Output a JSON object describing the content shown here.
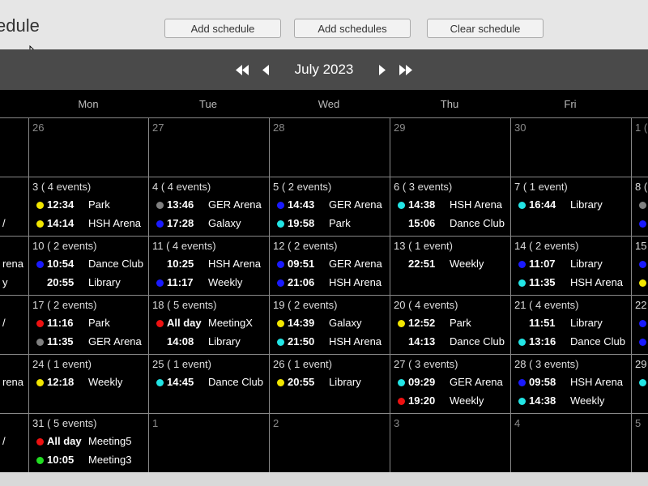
{
  "header": {
    "title": "edule",
    "buttons": [
      "Add schedule",
      "Add schedules",
      "Clear schedule"
    ]
  },
  "nav": {
    "month": "July 2023",
    "icons": [
      "double-left-arrow-icon",
      "left-arrow-icon",
      "right-arrow-icon",
      "double-right-arrow-icon"
    ]
  },
  "day_headers": [
    "Mon",
    "Tue",
    "Wed",
    "Thu",
    "Fri"
  ],
  "colors": {
    "yellow": "#f2e600",
    "gray": "#808080",
    "blue": "#1a1aff",
    "cyan": "#22e5e5",
    "red": "#ee1111",
    "green": "#22dd22",
    "black": "#000000"
  },
  "weeks": [
    [
      {
        "label": "",
        "events": []
      },
      {
        "label": "26",
        "events": []
      },
      {
        "label": "27",
        "events": []
      },
      {
        "label": "28",
        "events": []
      },
      {
        "label": "29",
        "events": []
      },
      {
        "label": "30",
        "events": []
      },
      {
        "label": "1 (",
        "events": []
      }
    ],
    [
      {
        "label": "",
        "events": [
          {
            "color": "black",
            "time": "",
            "place": ""
          },
          {
            "color": "black",
            "time": "",
            "place": "/"
          }
        ]
      },
      {
        "label": "3 ( 4 events)",
        "events": [
          {
            "color": "yellow",
            "time": "12:34",
            "place": "Park"
          },
          {
            "color": "yellow",
            "time": "14:14",
            "place": "HSH Arena"
          }
        ]
      },
      {
        "label": "4 ( 4 events)",
        "events": [
          {
            "color": "gray",
            "time": "13:46",
            "place": "GER Arena"
          },
          {
            "color": "blue",
            "time": "17:28",
            "place": "Galaxy"
          }
        ]
      },
      {
        "label": "5 ( 2 events)",
        "events": [
          {
            "color": "blue",
            "time": "14:43",
            "place": "GER Arena"
          },
          {
            "color": "cyan",
            "time": "19:58",
            "place": "Park"
          }
        ]
      },
      {
        "label": "6 ( 3 events)",
        "events": [
          {
            "color": "cyan",
            "time": "14:38",
            "place": "HSH Arena"
          },
          {
            "color": "black",
            "time": "15:06",
            "place": "Dance Club"
          }
        ]
      },
      {
        "label": "7 ( 1 event)",
        "events": [
          {
            "color": "cyan",
            "time": "16:44",
            "place": "Library"
          }
        ]
      },
      {
        "label": "8 (",
        "events": [
          {
            "color": "gray",
            "time": "",
            "place": ""
          },
          {
            "color": "blue",
            "time": "",
            "place": ""
          }
        ]
      }
    ],
    [
      {
        "label": "",
        "events": [
          {
            "color": "black",
            "time": "",
            "place": "rena"
          },
          {
            "color": "black",
            "time": "",
            "place": "y"
          }
        ]
      },
      {
        "label": "10 ( 2 events)",
        "events": [
          {
            "color": "blue",
            "time": "10:54",
            "place": "Dance Club"
          },
          {
            "color": "black",
            "time": "20:55",
            "place": "Library"
          }
        ]
      },
      {
        "label": "11 ( 4 events)",
        "events": [
          {
            "color": "black",
            "time": "10:25",
            "place": "HSH Arena"
          },
          {
            "color": "blue",
            "time": "11:17",
            "place": "Weekly"
          }
        ]
      },
      {
        "label": "12 ( 2 events)",
        "events": [
          {
            "color": "blue",
            "time": "09:51",
            "place": "GER Arena"
          },
          {
            "color": "blue",
            "time": "21:06",
            "place": "HSH Arena"
          }
        ]
      },
      {
        "label": "13 ( 1 event)",
        "events": [
          {
            "color": "black",
            "time": "22:51",
            "place": "Weekly"
          }
        ]
      },
      {
        "label": "14 ( 2 events)",
        "events": [
          {
            "color": "blue",
            "time": "11:07",
            "place": "Library"
          },
          {
            "color": "cyan",
            "time": "11:35",
            "place": "HSH Arena"
          }
        ]
      },
      {
        "label": "15",
        "events": [
          {
            "color": "blue",
            "time": "",
            "place": ""
          },
          {
            "color": "yellow",
            "time": "",
            "place": ""
          }
        ]
      }
    ],
    [
      {
        "label": "",
        "events": [
          {
            "color": "black",
            "time": "",
            "place": "/"
          },
          {
            "color": "black",
            "time": "",
            "place": ""
          }
        ]
      },
      {
        "label": "17 ( 2 events)",
        "events": [
          {
            "color": "red",
            "time": "11:16",
            "place": "Park"
          },
          {
            "color": "gray",
            "time": "11:35",
            "place": "GER Arena"
          }
        ]
      },
      {
        "label": "18 ( 5 events)",
        "events": [
          {
            "color": "red",
            "time": "All day",
            "place": "MeetingX"
          },
          {
            "color": "black",
            "time": "14:08",
            "place": "Library"
          }
        ]
      },
      {
        "label": "19 ( 2 events)",
        "events": [
          {
            "color": "yellow",
            "time": "14:39",
            "place": "Galaxy"
          },
          {
            "color": "cyan",
            "time": "21:50",
            "place": "HSH Arena"
          }
        ]
      },
      {
        "label": "20 ( 4 events)",
        "events": [
          {
            "color": "yellow",
            "time": "12:52",
            "place": "Park"
          },
          {
            "color": "black",
            "time": "14:13",
            "place": "Dance Club"
          }
        ]
      },
      {
        "label": "21 ( 4 events)",
        "events": [
          {
            "color": "black",
            "time": "11:51",
            "place": "Library"
          },
          {
            "color": "cyan",
            "time": "13:16",
            "place": "Dance Club"
          }
        ]
      },
      {
        "label": "22",
        "events": [
          {
            "color": "blue",
            "time": "",
            "place": ""
          },
          {
            "color": "blue",
            "time": "",
            "place": ""
          }
        ]
      }
    ],
    [
      {
        "label": "",
        "events": [
          {
            "color": "black",
            "time": "",
            "place": "rena"
          }
        ]
      },
      {
        "label": "24 ( 1 event)",
        "events": [
          {
            "color": "yellow",
            "time": "12:18",
            "place": "Weekly"
          }
        ]
      },
      {
        "label": "25 ( 1 event)",
        "events": [
          {
            "color": "cyan",
            "time": "14:45",
            "place": "Dance Club"
          }
        ]
      },
      {
        "label": "26 ( 1 event)",
        "events": [
          {
            "color": "yellow",
            "time": "20:55",
            "place": "Library"
          }
        ]
      },
      {
        "label": "27 ( 3 events)",
        "events": [
          {
            "color": "cyan",
            "time": "09:29",
            "place": "GER Arena"
          },
          {
            "color": "red",
            "time": "19:20",
            "place": "Weekly"
          }
        ]
      },
      {
        "label": "28 ( 3 events)",
        "events": [
          {
            "color": "blue",
            "time": "09:58",
            "place": "HSH Arena"
          },
          {
            "color": "cyan",
            "time": "14:38",
            "place": "Weekly"
          }
        ]
      },
      {
        "label": "29",
        "events": [
          {
            "color": "cyan",
            "time": "",
            "place": ""
          }
        ]
      }
    ],
    [
      {
        "label": "",
        "events": [
          {
            "color": "black",
            "time": "",
            "place": "/"
          },
          {
            "color": "black",
            "time": "",
            "place": ""
          }
        ]
      },
      {
        "label": "31 ( 5 events)",
        "events": [
          {
            "color": "red",
            "time": "All day",
            "place": "Meeting5"
          },
          {
            "color": "green",
            "time": "10:05",
            "place": "Meeting3"
          }
        ]
      },
      {
        "label": "1",
        "events": []
      },
      {
        "label": "2",
        "events": []
      },
      {
        "label": "3",
        "events": []
      },
      {
        "label": "4",
        "events": []
      },
      {
        "label": "5",
        "events": []
      }
    ]
  ]
}
